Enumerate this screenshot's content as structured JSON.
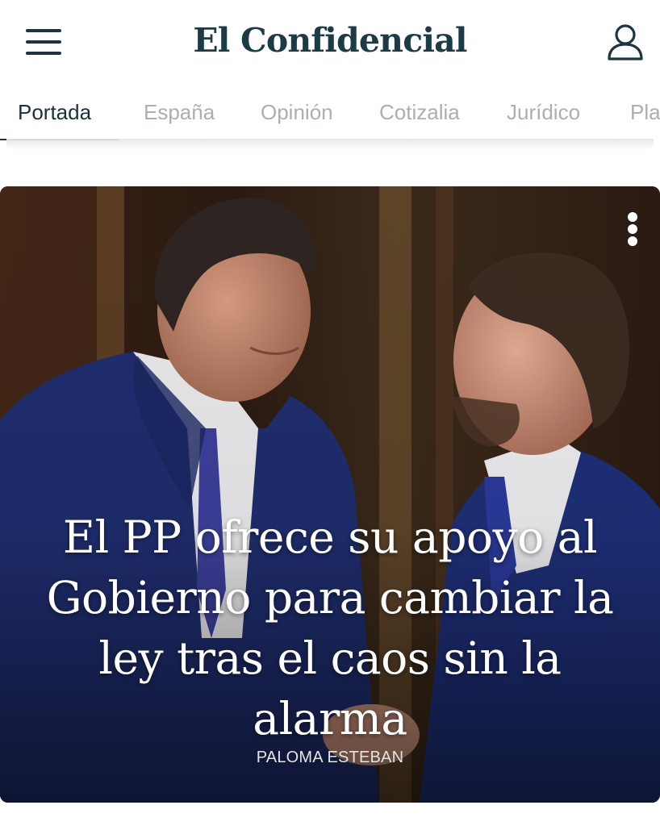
{
  "header": {
    "logo": "El Confidencial",
    "menu_icon": "hamburger-menu-icon",
    "user_icon": "user-icon"
  },
  "tabs": [
    {
      "label": "Portada",
      "active": true
    },
    {
      "label": "España",
      "active": false
    },
    {
      "label": "Opinión",
      "active": false
    },
    {
      "label": "Cotizalia",
      "active": false
    },
    {
      "label": "Jurídico",
      "active": false
    },
    {
      "label": "Pla",
      "active": false
    }
  ],
  "hero": {
    "headline": "El PP ofrece su apoyo al Gobierno para cambiar la ley tras el caos sin la alarma",
    "author": "PALOMA ESTEBAN",
    "more_icon": "more-vertical-icon"
  },
  "colors": {
    "brand": "#1b3b47",
    "tab_inactive": "#a9afb3",
    "tab_active": "#1d2f37"
  }
}
